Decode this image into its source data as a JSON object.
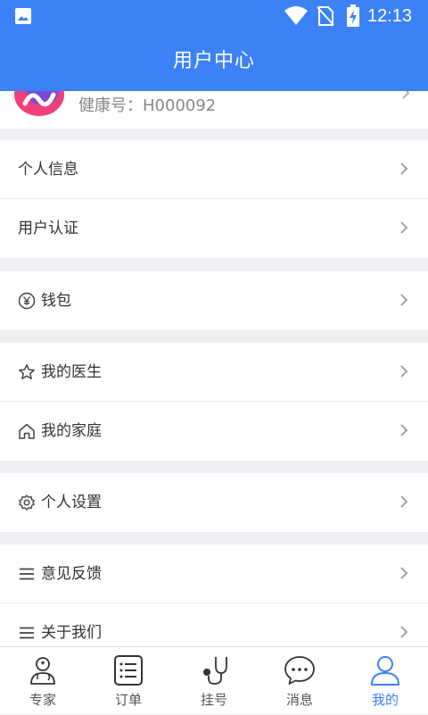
{
  "status_bar": {
    "time": "12:13"
  },
  "header": {
    "title": "用户中心"
  },
  "profile": {
    "health_id": "健康号：H000092"
  },
  "groups": [
    {
      "items": [
        {
          "label": "个人信息"
        },
        {
          "label": "用户认证"
        }
      ]
    },
    {
      "items": [
        {
          "label": "钱包",
          "icon": "yuan-icon"
        }
      ]
    },
    {
      "items": [
        {
          "label": "我的医生",
          "icon": "star-icon"
        },
        {
          "label": "我的家庭",
          "icon": "home-icon"
        }
      ]
    },
    {
      "items": [
        {
          "label": "个人设置",
          "icon": "gear-icon"
        }
      ]
    },
    {
      "items": [
        {
          "label": "意见反馈",
          "icon": "menu-icon"
        },
        {
          "label": "关于我们",
          "icon": "menu-icon"
        }
      ]
    }
  ],
  "tabbar": {
    "tabs": [
      {
        "label": "专家",
        "icon": "doctor-icon"
      },
      {
        "label": "订单",
        "icon": "list-icon"
      },
      {
        "label": "挂号",
        "icon": "stethoscope-icon"
      },
      {
        "label": "消息",
        "icon": "chat-icon"
      },
      {
        "label": "我的",
        "icon": "user-icon",
        "active": true
      }
    ]
  },
  "colors": {
    "accent": "#3c82f6",
    "background": "#efeef3"
  }
}
